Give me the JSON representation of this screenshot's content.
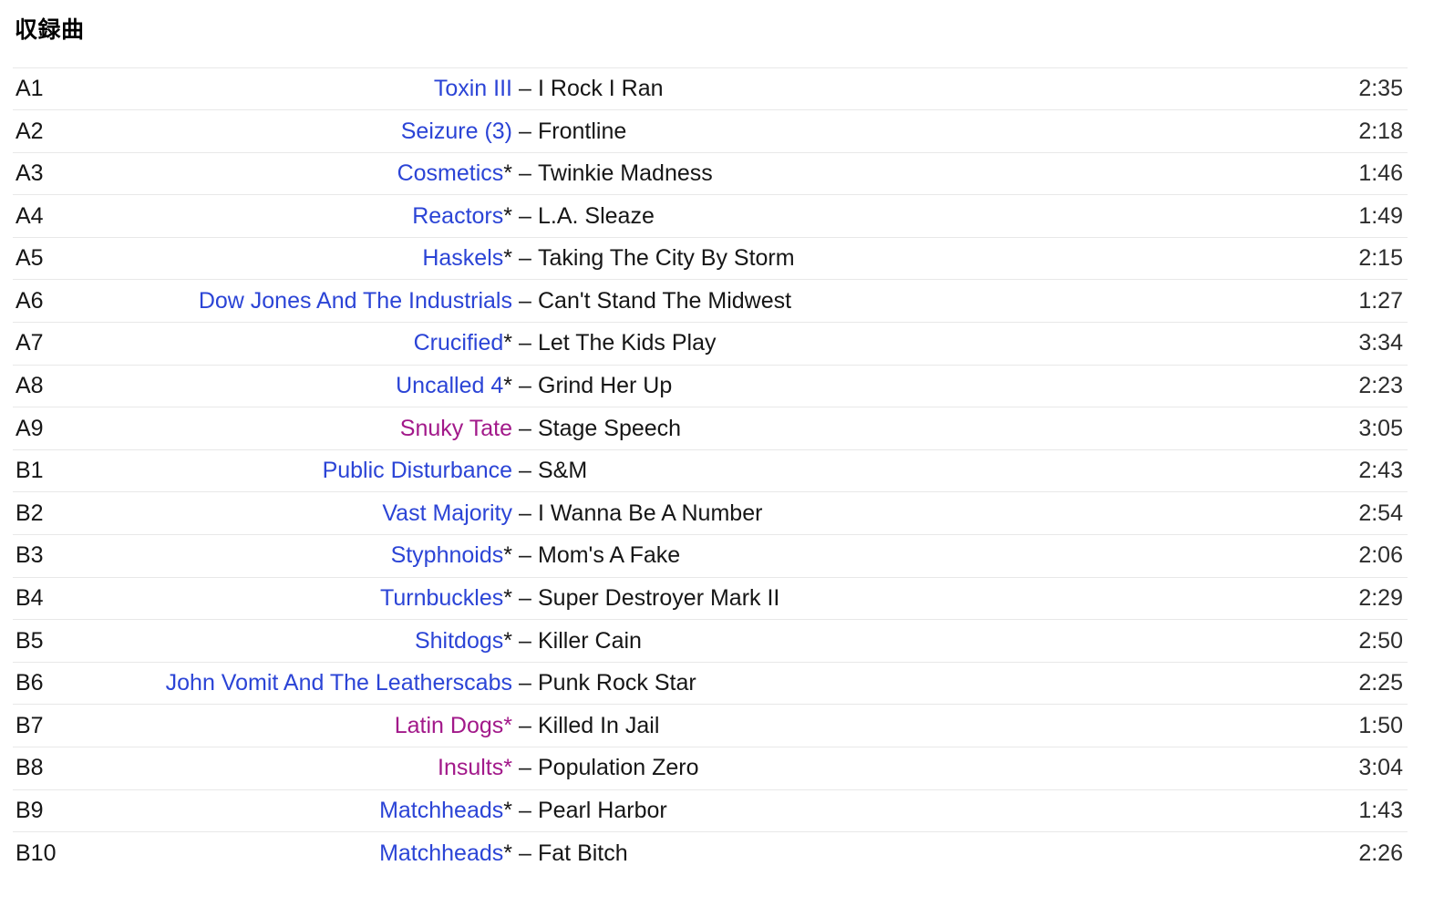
{
  "section": {
    "title": "収録曲"
  },
  "tracklist": {
    "separator": "–",
    "link_color": "#2b44d6",
    "visited_link_color": "#a2198a",
    "divider_color": "#e8e8e8",
    "tracks": [
      {
        "position": "A1",
        "artist": "Toxin III",
        "artist_state": "link",
        "star": "",
        "title": "I Rock I Ran",
        "duration": "2:35"
      },
      {
        "position": "A2",
        "artist": "Seizure (3)",
        "artist_state": "link",
        "star": "",
        "title": "Frontline",
        "duration": "2:18"
      },
      {
        "position": "A3",
        "artist": "Cosmetics",
        "artist_state": "link",
        "star": "*",
        "title": "Twinkie Madness",
        "duration": "1:46"
      },
      {
        "position": "A4",
        "artist": "Reactors",
        "artist_state": "link",
        "star": "*",
        "title": "L.A. Sleaze",
        "duration": "1:49"
      },
      {
        "position": "A5",
        "artist": "Haskels",
        "artist_state": "link",
        "star": "*",
        "title": "Taking The City By Storm",
        "duration": "2:15"
      },
      {
        "position": "A6",
        "artist": "Dow Jones And The Industrials",
        "artist_state": "link",
        "star": "",
        "title": "Can't Stand The Midwest",
        "duration": "1:27"
      },
      {
        "position": "A7",
        "artist": "Crucified",
        "artist_state": "link",
        "star": "*",
        "title": "Let The Kids Play",
        "duration": "3:34"
      },
      {
        "position": "A8",
        "artist": "Uncalled 4",
        "artist_state": "link",
        "star": "*",
        "title": "Grind Her Up",
        "duration": "2:23"
      },
      {
        "position": "A9",
        "artist": "Snuky Tate",
        "artist_state": "visited",
        "star": "",
        "title": "Stage Speech",
        "duration": "3:05"
      },
      {
        "position": "B1",
        "artist": "Public Disturbance",
        "artist_state": "link",
        "star": "",
        "title": "S&M",
        "duration": "2:43"
      },
      {
        "position": "B2",
        "artist": "Vast Majority",
        "artist_state": "link",
        "star": "",
        "title": "I Wanna Be A Number",
        "duration": "2:54"
      },
      {
        "position": "B3",
        "artist": "Styphnoids",
        "artist_state": "link",
        "star": "*",
        "title": "Mom's A Fake",
        "duration": "2:06"
      },
      {
        "position": "B4",
        "artist": "Turnbuckles",
        "artist_state": "link",
        "star": "*",
        "title": "Super Destroyer Mark II",
        "duration": "2:29"
      },
      {
        "position": "B5",
        "artist": "Shitdogs",
        "artist_state": "link",
        "star": "*",
        "title": "Killer Cain",
        "duration": "2:50"
      },
      {
        "position": "B6",
        "artist": "John Vomit And The Leatherscabs",
        "artist_state": "link",
        "star": "",
        "title": "Punk Rock Star",
        "duration": "2:25"
      },
      {
        "position": "B7",
        "artist": "Latin Dogs",
        "artist_state": "visited",
        "star": "*",
        "title": "Killed In Jail",
        "duration": "1:50"
      },
      {
        "position": "B8",
        "artist": "Insults",
        "artist_state": "visited",
        "star": "*",
        "title": "Population Zero",
        "duration": "3:04"
      },
      {
        "position": "B9",
        "artist": "Matchheads",
        "artist_state": "link",
        "star": "*",
        "title": "Pearl Harbor",
        "duration": "1:43"
      },
      {
        "position": "B10",
        "artist": "Matchheads",
        "artist_state": "link",
        "star": "*",
        "title": "Fat Bitch",
        "duration": "2:26"
      }
    ]
  }
}
